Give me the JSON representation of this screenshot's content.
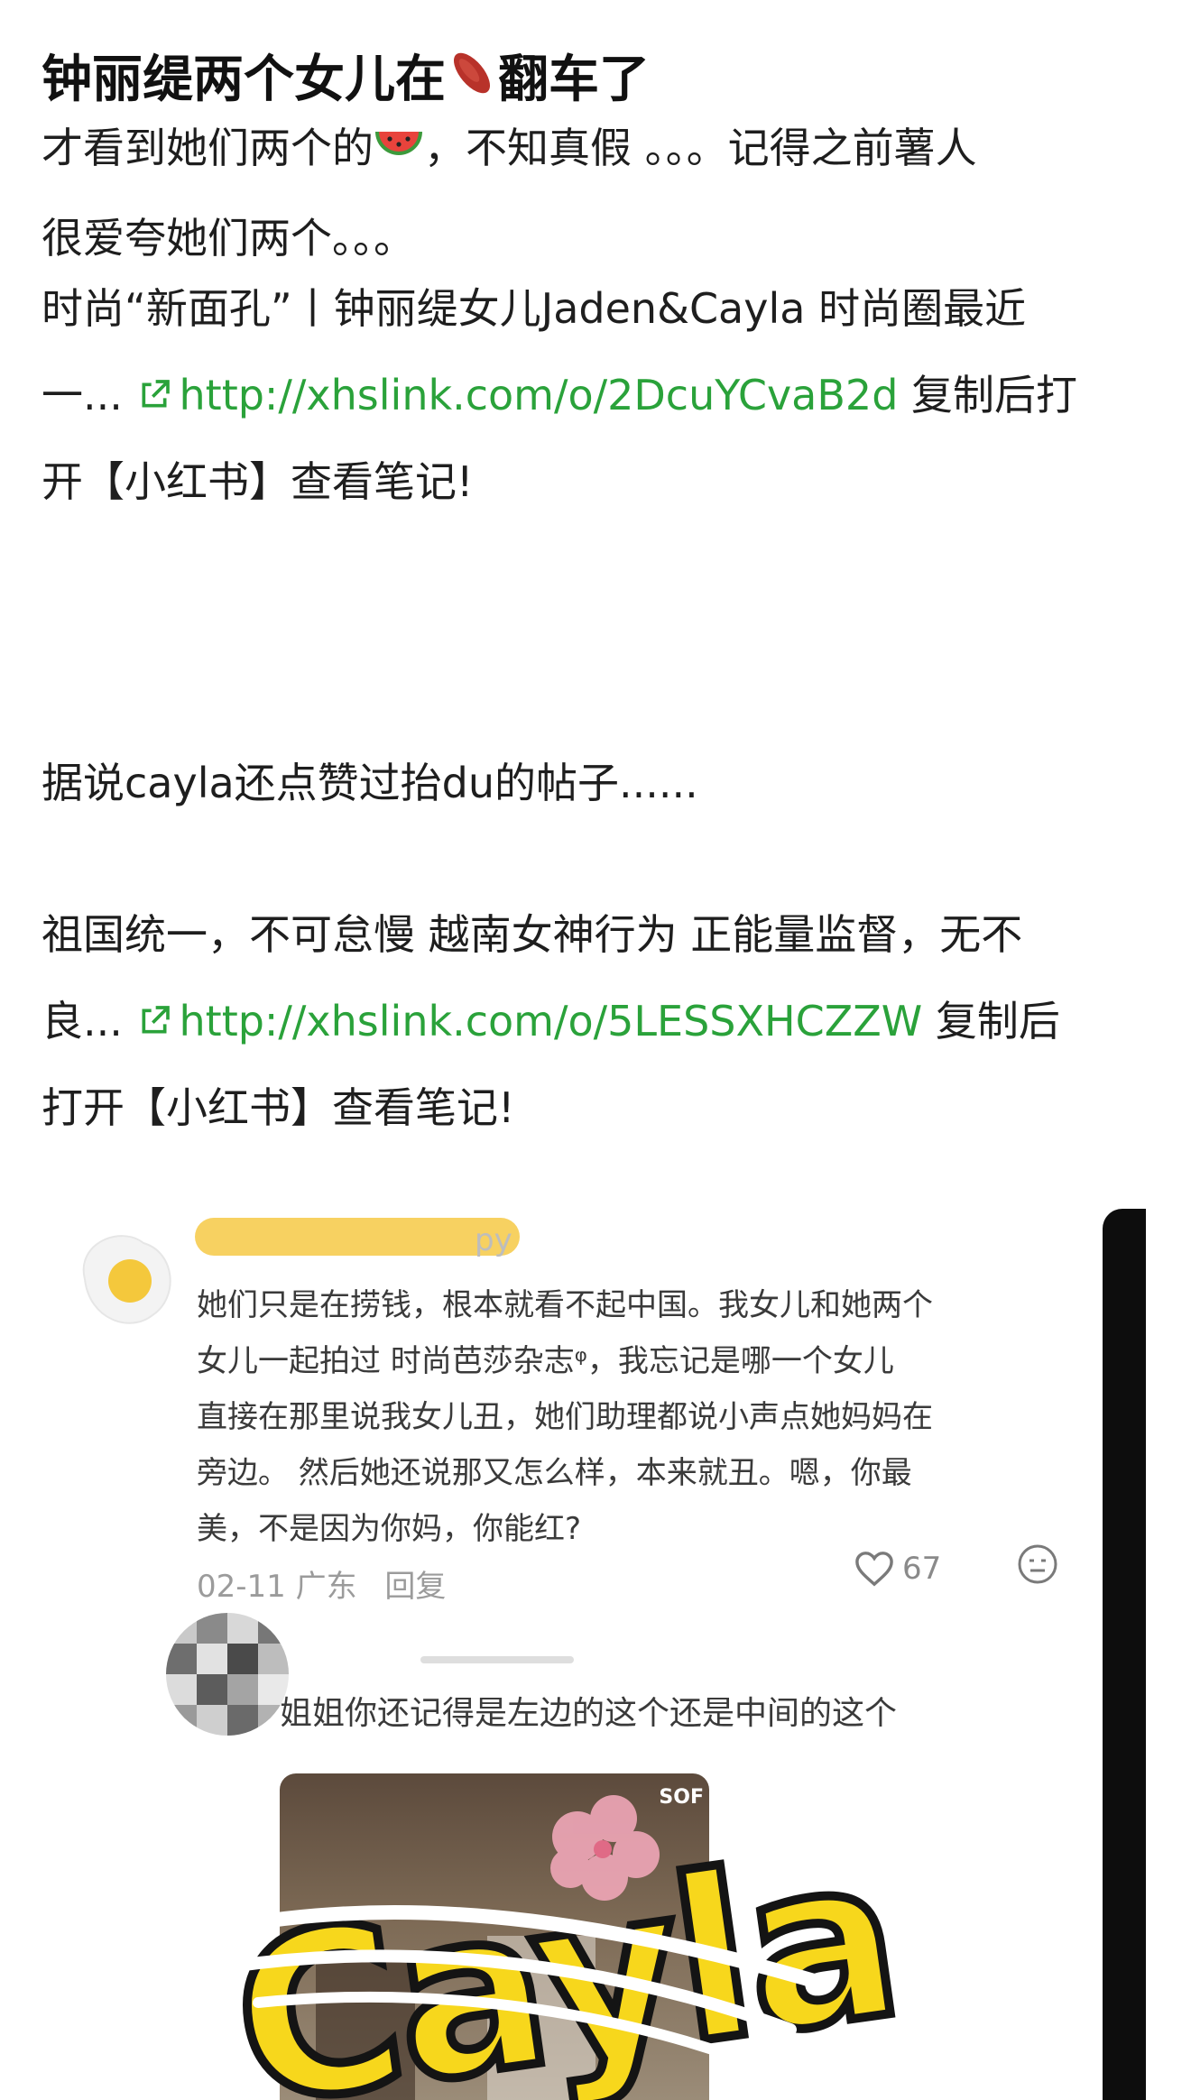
{
  "post": {
    "title": "钟丽缇两个女儿在",
    "title_emoji": "sweet-potato-icon",
    "title_suffix": "翻车了",
    "p1_a": "才看到她们两个的",
    "p1_emoji": "watermelon-icon",
    "p1_b": "，不知真假 。。。记得之前薯人",
    "p1_c": "很爱夸她们两个。。。",
    "p2_a": "时尚“新面孔”丨钟丽缇女儿Jaden&Cayla 时尚圈最近",
    "p2_b": "一...",
    "p2_link": "http://xhslink.com/o/2DcuYCvaB2d",
    "p2_c": " 复制后打",
    "p2_d": "开【小红书】查看笔记!",
    "p3": "据说cayla还点赞过抬du的帖子......",
    "p4_a": "祖国统一，不可怠慢 越南女神行为 正能量监督，无不",
    "p4_b": "良...",
    "p4_link": "http://xhslink.com/o/5LESSXHCZZW",
    "p4_c": " 复制后",
    "p4_d": "打开【小红书】查看笔记!"
  },
  "embedded": {
    "username_fragment": "py",
    "comment_lines": [
      "她们只是在捞钱，根本就看不起中国。我女儿和她两个",
      "女儿一起拍过 时尚芭莎杂志ᵠ，我忘记是哪一个女儿",
      "直接在那里说我女儿丑，她们助理都说小声点她妈妈在",
      "旁边。 然后她还说那又怎么样，本来就丑。嗯，你最",
      "美，不是因为你妈，你能红?"
    ],
    "meta_date": "02-11 广东",
    "meta_reply": "回复",
    "like_count": "67",
    "reply_text": "姐姐你还记得是左边的这个还是中间的这个",
    "sticker_text": "Cayla",
    "thumb_badge": "SOF"
  },
  "colors": {
    "link": "#2aa23a",
    "sticker": "#f7d71c"
  }
}
